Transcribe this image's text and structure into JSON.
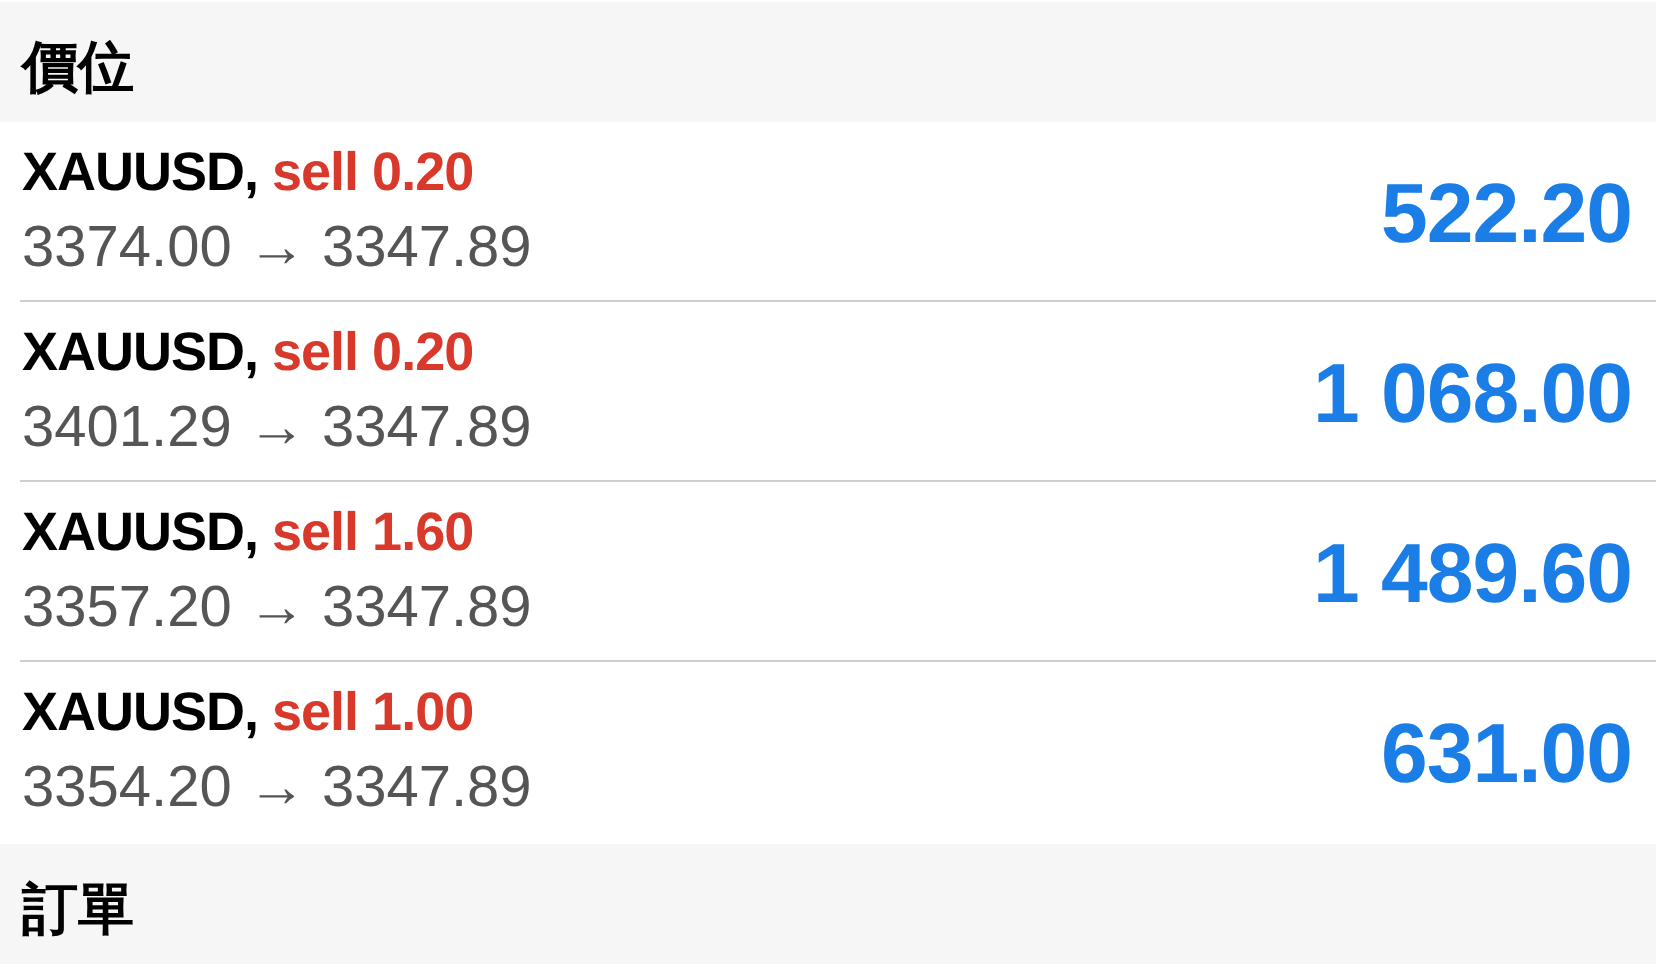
{
  "sections": [
    {
      "title": "價位",
      "positions": [
        {
          "symbol": "XAUUSD,",
          "trade": "sell 0.20",
          "prices": "3374.00 → 3347.89",
          "profit": "522.20"
        },
        {
          "symbol": "XAUUSD,",
          "trade": "sell 0.20",
          "prices": "3401.29 → 3347.89",
          "profit": "1 068.00"
        },
        {
          "symbol": "XAUUSD,",
          "trade": "sell 1.60",
          "prices": "3357.20 → 3347.89",
          "profit": "1 489.60"
        },
        {
          "symbol": "XAUUSD,",
          "trade": "sell 1.00",
          "prices": "3354.20 → 3347.89",
          "profit": "631.00"
        }
      ]
    },
    {
      "title": "訂單"
    }
  ]
}
